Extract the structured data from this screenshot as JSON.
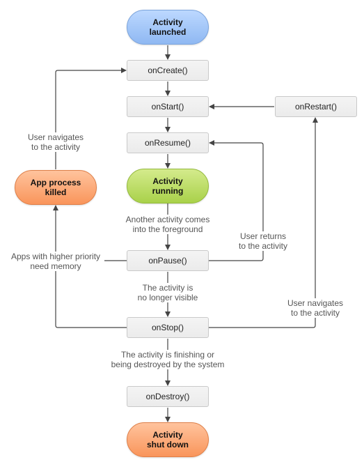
{
  "diagram": {
    "states": {
      "launched": {
        "line1": "Activity",
        "line2": "launched",
        "color": "#a9c8f7"
      },
      "running": {
        "line1": "Activity",
        "line2": "running",
        "color": "#bfe06a"
      },
      "killed": {
        "line1": "App process",
        "line2": "killed",
        "color": "#fbab7b"
      },
      "shutdown": {
        "line1": "Activity",
        "line2": "shut down",
        "color": "#fbab7b"
      }
    },
    "callbacks": {
      "onCreate": "onCreate()",
      "onStart": "onStart()",
      "onResume": "onResume()",
      "onPause": "onPause()",
      "onStop": "onStop()",
      "onDestroy": "onDestroy()",
      "onRestart": "onRestart()"
    },
    "transitions": {
      "user_navigates_left": {
        "line1": "User navigates",
        "line2": "to the activity"
      },
      "another_activity": {
        "line1": "Another activity comes",
        "line2": "into the foreground"
      },
      "user_returns": {
        "line1": "User returns",
        "line2": "to the activity"
      },
      "higher_priority": {
        "line1": "Apps with higher priority",
        "line2": "need memory"
      },
      "no_longer_visible": {
        "line1": "The activity is",
        "line2": "no longer visible"
      },
      "user_navigates_right": {
        "line1": "User navigates",
        "line2": "to the activity"
      },
      "finishing": {
        "line1": "The activity is finishing or",
        "line2": "being destroyed by the system"
      }
    }
  }
}
